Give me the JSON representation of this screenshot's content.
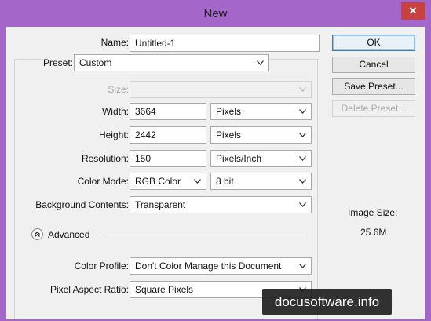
{
  "window": {
    "title": "New",
    "close_glyph": "✕"
  },
  "form": {
    "name_label": "Name:",
    "name_value": "Untitled-1",
    "preset_label": "Preset:",
    "preset_value": "Custom",
    "size_label": "Size:",
    "size_value": "",
    "width_label": "Width:",
    "width_value": "3664",
    "width_unit": "Pixels",
    "height_label": "Height:",
    "height_value": "2442",
    "height_unit": "Pixels",
    "resolution_label": "Resolution:",
    "resolution_value": "150",
    "resolution_unit": "Pixels/Inch",
    "color_mode_label": "Color Mode:",
    "color_mode_value": "RGB Color",
    "bit_depth_value": "8 bit",
    "background_label": "Background Contents:",
    "background_value": "Transparent",
    "advanced_label": "Advanced",
    "color_profile_label": "Color Profile:",
    "color_profile_value": "Don't Color Manage this Document",
    "pixel_aspect_label": "Pixel Aspect Ratio:",
    "pixel_aspect_value": "Square Pixels"
  },
  "buttons": {
    "ok": "OK",
    "cancel": "Cancel",
    "save_preset": "Save Preset...",
    "delete_preset": "Delete Preset..."
  },
  "image_size": {
    "label": "Image Size:",
    "value": "25.6M"
  },
  "watermark": "docusoftware.info",
  "colors": {
    "window_frame": "#a467c9",
    "dialog_bg": "#f0f0f0",
    "close_button": "#c9413f",
    "default_button_border": "#3c7fb1"
  },
  "icons": {
    "dropdown": "chevron-down-icon",
    "advanced_toggle": "collapse-up-icon",
    "close": "close-icon"
  }
}
